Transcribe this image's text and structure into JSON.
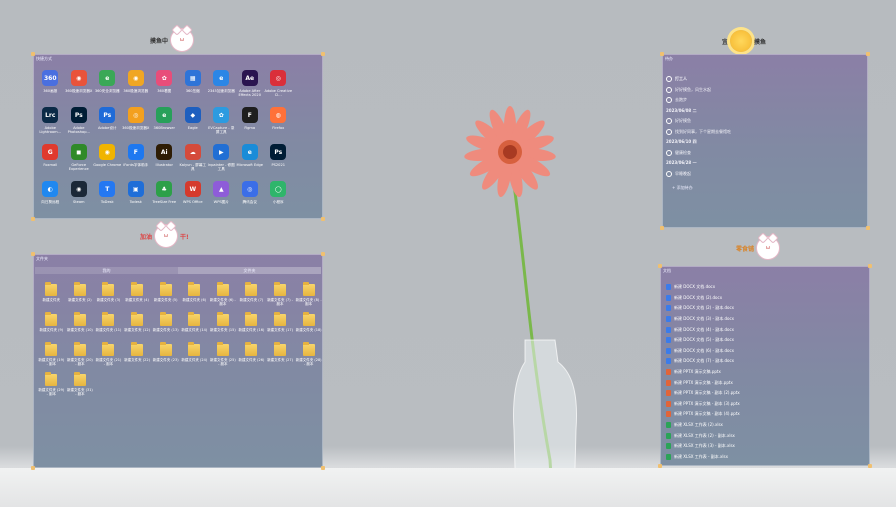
{
  "stickers": {
    "top_left": "摸鱼中",
    "mid_left": [
      "加油",
      "干!"
    ],
    "top_right": [
      "宜",
      "摸鱼"
    ],
    "mid_right": "零食铺"
  },
  "apps_panel": {
    "title": "快捷方式",
    "apps": [
      {
        "name": "360画报",
        "color": "#4a6fe0",
        "glyph": "360"
      },
      {
        "name": "360极速浏览器X",
        "color": "#e9533b",
        "glyph": "◉"
      },
      {
        "name": "360安全浏览器",
        "color": "#3aa857",
        "glyph": "e"
      },
      {
        "name": "360极速浏览器",
        "color": "#f0a623",
        "glyph": "◉"
      },
      {
        "name": "360看图",
        "color": "#e84d7a",
        "glyph": "✿"
      },
      {
        "name": "360压缩",
        "color": "#2f74d8",
        "glyph": "▦"
      },
      {
        "name": "2345加速浏览器",
        "color": "#2b86e6",
        "glyph": "e"
      },
      {
        "name": "Adobe After Effects 2020",
        "color": "#2a1450",
        "glyph": "Ae"
      },
      {
        "name": "Adobe Creative Cl...",
        "color": "#da2f3a",
        "glyph": "◎"
      },
      {
        "name": "",
        "color": "transparent",
        "glyph": ""
      },
      {
        "name": "Adobe Lightroom...",
        "color": "#0b2a47",
        "glyph": "Lrc"
      },
      {
        "name": "Adobe Photoshop...",
        "color": "#001d35",
        "glyph": "Ps"
      },
      {
        "name": "Adobe设计",
        "color": "#1f6bd8",
        "glyph": "Ps"
      },
      {
        "name": "360极速浏览器X",
        "color": "#f3a01f",
        "glyph": "◎"
      },
      {
        "name": "360Browser",
        "color": "#27a05a",
        "glyph": "e"
      },
      {
        "name": "Eagle",
        "color": "#1e5fbf",
        "glyph": "◆"
      },
      {
        "name": "EVCapture - 录屏工具",
        "color": "#2c9be0",
        "glyph": "✿"
      },
      {
        "name": "Figma",
        "color": "#1e1e1e",
        "glyph": "F"
      },
      {
        "name": "Firefox",
        "color": "#ff7139",
        "glyph": "◍"
      },
      {
        "name": "",
        "color": "transparent",
        "glyph": ""
      },
      {
        "name": "Foxmail",
        "color": "#e03a2d",
        "glyph": "G"
      },
      {
        "name": "GeForce Experience",
        "color": "#2f8a29",
        "glyph": "◼"
      },
      {
        "name": "Google Chrome",
        "color": "#f0b400",
        "glyph": "◉"
      },
      {
        "name": "iFonts字体助手",
        "color": "#1e78f0",
        "glyph": "F"
      },
      {
        "name": "Illustrator",
        "color": "#2e1d05",
        "glyph": "Ai"
      },
      {
        "name": "Kaiyun - 屏幕工具",
        "color": "#d54b3b",
        "glyph": "☁"
      },
      {
        "name": "Inpainter - 修图工具",
        "color": "#226fd4",
        "glyph": "▶"
      },
      {
        "name": "Microsoft Edge",
        "color": "#1a8cd8",
        "glyph": "e"
      },
      {
        "name": "PS2021",
        "color": "#001d35",
        "glyph": "Ps"
      },
      {
        "name": "",
        "color": "transparent",
        "glyph": ""
      },
      {
        "name": "向日葵远程",
        "color": "#2088f0",
        "glyph": "◐"
      },
      {
        "name": "Steam",
        "color": "#1b2838",
        "glyph": "◉"
      },
      {
        "name": "ToDesk",
        "color": "#2478f2",
        "glyph": "T"
      },
      {
        "name": "Todesk",
        "color": "#1f6ed8",
        "glyph": "▣"
      },
      {
        "name": "TreeSize Free",
        "color": "#2da049",
        "glyph": "♣"
      },
      {
        "name": "WPS Office",
        "color": "#d53a2d",
        "glyph": "W"
      },
      {
        "name": "WPS图片",
        "color": "#8e5cd9",
        "glyph": "▲"
      },
      {
        "name": "腾讯会议",
        "color": "#3b6ee8",
        "glyph": "◎"
      },
      {
        "name": "小程序",
        "color": "#2fb56b",
        "glyph": "◯"
      },
      {
        "name": "",
        "color": "transparent",
        "glyph": ""
      }
    ]
  },
  "folder_panel": {
    "title": "文件夹",
    "tabs": [
      "我的",
      "文件夹"
    ],
    "folders": [
      "新建文件夹",
      "新建文件夹 (2)",
      "新建文件夹 (3)",
      "新建文件夹 (4)",
      "新建文件夹 (5)",
      "新建文件夹 (6)",
      "新建文件夹 (6) - 副本",
      "新建文件夹 (7)",
      "新建文件夹 (7) - 副本",
      "新建文件夹 (8) - 副本",
      "新建文件夹 (9)",
      "新建文件夹 (10)",
      "新建文件夹 (11)",
      "新建文件夹 (12)",
      "新建文件夹 (13)",
      "新建文件夹 (14)",
      "新建文件夹 (15)",
      "新建文件夹 (16)",
      "新建文件夹 (17)",
      "新建文件夹 (18)",
      "新建文件夹 (19) - 副本",
      "新建文件夹 (20) - 副本",
      "新建文件夹 (21) - 副本",
      "新建文件夹 (22)",
      "新建文件夹 (23)",
      "新建文件夹 (24)",
      "新建文件夹 (25) - 副本",
      "新建文件夹 (26)",
      "新建文件夹 (27)",
      "新建文件夹 (28) - 副本",
      "新建文件夹 (29) - 副本",
      "新建文件夹 (31) - 副本"
    ]
  },
  "todo_panel": {
    "title": "待办",
    "items": [
      {
        "text": "打工人",
        "kind": "first"
      },
      {
        "text": "好好摸鱼，风生水起",
        "kind": "item"
      },
      {
        "text": "去跑步",
        "kind": "item"
      },
      {
        "text": "2023/06/08 二",
        "kind": "date"
      },
      {
        "text": "好好摸鱼",
        "kind": "item"
      },
      {
        "text": "找到好同事，下个星期去餐馆吃",
        "kind": "item"
      },
      {
        "text": "2023/06/10 四",
        "kind": "date"
      },
      {
        "text": "健康检查",
        "kind": "item"
      },
      {
        "text": "2023/06/28 一",
        "kind": "date"
      },
      {
        "text": "早睡晚起",
        "kind": "item"
      }
    ],
    "footer": "+ 添加待办"
  },
  "files_panel": {
    "title": "文档",
    "files": [
      {
        "name": "新建 DOCX 文档.docx",
        "type": "doc"
      },
      {
        "name": "新建 DOCX 文档 (2).docx",
        "type": "doc"
      },
      {
        "name": "新建 DOCX 文档 (2) - 副本.docx",
        "type": "doc"
      },
      {
        "name": "新建 DOCX 文档 (3) - 副本.docx",
        "type": "doc"
      },
      {
        "name": "新建 DOCX 文档 (4) - 副本.docx",
        "type": "doc"
      },
      {
        "name": "新建 DOCX 文档 (5) - 副本.docx",
        "type": "doc"
      },
      {
        "name": "新建 DOCX 文档 (6) - 副本.docx",
        "type": "doc"
      },
      {
        "name": "新建 DOCX 文档 (7) - 副本.docx",
        "type": "doc"
      },
      {
        "name": "新建 PPTX 演示文稿.pptx",
        "type": "ppt"
      },
      {
        "name": "新建 PPTX 演示文稿 - 副本.pptx",
        "type": "ppt"
      },
      {
        "name": "新建 PPTX 演示文稿 - 副本 (2).pptx",
        "type": "ppt"
      },
      {
        "name": "新建 PPTX 演示文稿 - 副本 (3).pptx",
        "type": "ppt"
      },
      {
        "name": "新建 PPTX 演示文稿 - 副本 (4).pptx",
        "type": "ppt"
      },
      {
        "name": "新建 XLSX 工作表 (2).xlsx",
        "type": "xls"
      },
      {
        "name": "新建 XLSX 工作表 (2) - 副本.xlsx",
        "type": "xls"
      },
      {
        "name": "新建 XLSX 工作表 (3) - 副本.xlsx",
        "type": "xls"
      },
      {
        "name": "新建 XLSX 工作表 - 副本.xlsx",
        "type": "xls"
      }
    ]
  },
  "file_colors": {
    "doc": "#3b7bea",
    "ppt": "#e0643a",
    "xls": "#2aa357"
  }
}
